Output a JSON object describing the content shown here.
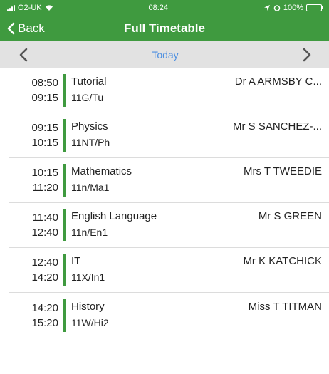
{
  "status": {
    "carrier": "O2-UK",
    "time": "08:24",
    "battery": "100%",
    "battery_level": 1.0
  },
  "nav": {
    "back_label": "Back",
    "title": "Full Timetable"
  },
  "date_bar": {
    "prev_icon": "chevron-left-icon",
    "today_label": "Today",
    "next_icon": "chevron-right-icon"
  },
  "colors": {
    "brand_green": "#3f9a3f",
    "today_blue": "#4d8fe0",
    "date_bar_bg": "#e2e2e2"
  },
  "lessons": [
    {
      "start": "08:50",
      "end": "09:15",
      "subject": "Tutorial",
      "group": "11G/Tu",
      "teacher": "Dr A ARMSBY C..."
    },
    {
      "start": "09:15",
      "end": "10:15",
      "subject": "Physics",
      "group": "11NT/Ph",
      "teacher": "Mr S SANCHEZ-..."
    },
    {
      "start": "10:15",
      "end": "11:20",
      "subject": "Mathematics",
      "group": "11n/Ma1",
      "teacher": "Mrs T TWEEDIE"
    },
    {
      "start": "11:40",
      "end": "12:40",
      "subject": "English Language",
      "group": "11n/En1",
      "teacher": "Mr S GREEN"
    },
    {
      "start": "12:40",
      "end": "14:20",
      "subject": "IT",
      "group": "11X/In1",
      "teacher": "Mr K KATCHICK"
    },
    {
      "start": "14:20",
      "end": "15:20",
      "subject": "History",
      "group": "11W/Hi2",
      "teacher": "Miss T TITMAN"
    }
  ]
}
